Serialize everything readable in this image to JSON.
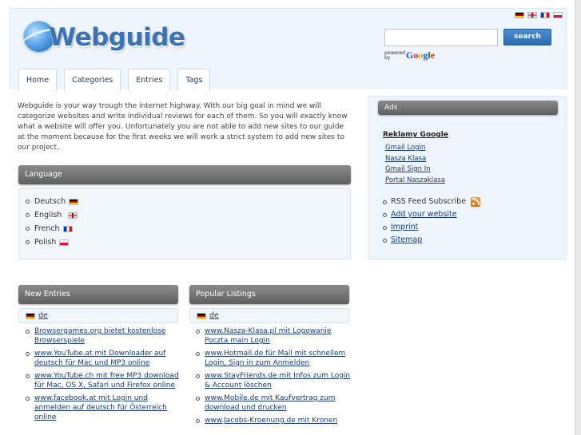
{
  "site": {
    "logo_text": "Webguide"
  },
  "header": {
    "flags": [
      "de",
      "en",
      "fr",
      "pl"
    ],
    "search": {
      "value": "",
      "button_label": "search",
      "powered_by": "powered by",
      "google": [
        "G",
        "o",
        "o",
        "g",
        "l",
        "e"
      ]
    }
  },
  "nav": {
    "tabs": [
      "Home",
      "Categories",
      "Entries",
      "Tags"
    ]
  },
  "intro": "Webguide is your way trough the internet highway. With our big goal in mind we will categorize websites and write individual reviews for each of them. So you will exactly know what a website will offer you. Unfortunately you are not able to add new sites to our guide at the moment because for the first weeks we will work a strict system to add new sites to our project.",
  "language": {
    "title": "Language",
    "items": [
      {
        "label": "Deutsch",
        "flag": "de"
      },
      {
        "label": "English",
        "flag": "en"
      },
      {
        "label": "French",
        "flag": "fr"
      },
      {
        "label": "Polish",
        "flag": "pl"
      }
    ]
  },
  "sidebar": {
    "ads_title": "Ads",
    "ads_heading": "Reklamy Google",
    "ad_links": [
      "Gmail Login",
      "Nasza Klasa",
      "Gmail Sign In",
      "Portal Naszaklasa"
    ],
    "links": [
      "RSS Feed Subscribe",
      "Add your website",
      "Imprint",
      "Sitemap"
    ]
  },
  "new_entries": {
    "title": "New Entries",
    "lang": "de",
    "items": [
      "Browsergames.org bietet kostenlose Browserspiele",
      "www.YouTube.at mit Downloader auf deutsch für Mac und MP3 online",
      "www.YouTube.ch mit free MP3 download für Mac, OS X, Safari und Firefox online",
      "www.facebook.at mit Login und anmelden auf deutsch für Österreich online"
    ]
  },
  "popular": {
    "title": "Popular Listings",
    "lang": "de",
    "items": [
      "www.Nasza-Klasa.pl mit Logowanie Poczta main Login",
      "www.Hotmail.de für Mail mit schnellem Login, Sign in zum Anmelden",
      "www.StayFriends.de mit Infos zum Login & Account löschen",
      "www.Mobile.de mit Kaufvertrag zum download und drucken",
      "www.Jacobs-Kroenung.de mit Kronen"
    ]
  }
}
